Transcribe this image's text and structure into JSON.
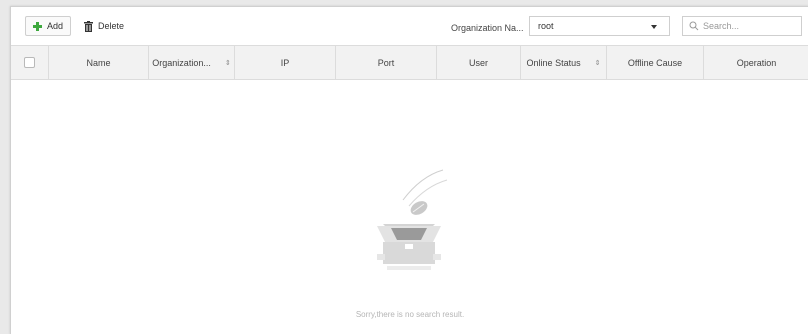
{
  "toolbar": {
    "add_label": "Add",
    "delete_label": "Delete",
    "org_label": "Organization Na...",
    "org_value": "root",
    "search_placeholder": "Search..."
  },
  "table": {
    "columns": [
      {
        "label": "",
        "sortable": false
      },
      {
        "label": "Name",
        "sortable": false
      },
      {
        "label": "Organization...",
        "sortable": true
      },
      {
        "label": "IP",
        "sortable": false
      },
      {
        "label": "Port",
        "sortable": false
      },
      {
        "label": "User",
        "sortable": false
      },
      {
        "label": "Online Status",
        "sortable": true
      },
      {
        "label": "Offline Cause",
        "sortable": false
      },
      {
        "label": "Operation",
        "sortable": false
      }
    ],
    "sort_glyph": "⇕",
    "empty_text": "Sorry,there is no search result."
  },
  "icons": {
    "add": "plus-icon",
    "delete": "trash-icon",
    "dropdown": "caret-down-icon",
    "search": "search-icon",
    "empty": "empty-box-icon"
  },
  "colors": {
    "add_icon": "#3ea83e",
    "header_bg": "#f2f2f2",
    "page_bg": "#e9e9e9"
  }
}
